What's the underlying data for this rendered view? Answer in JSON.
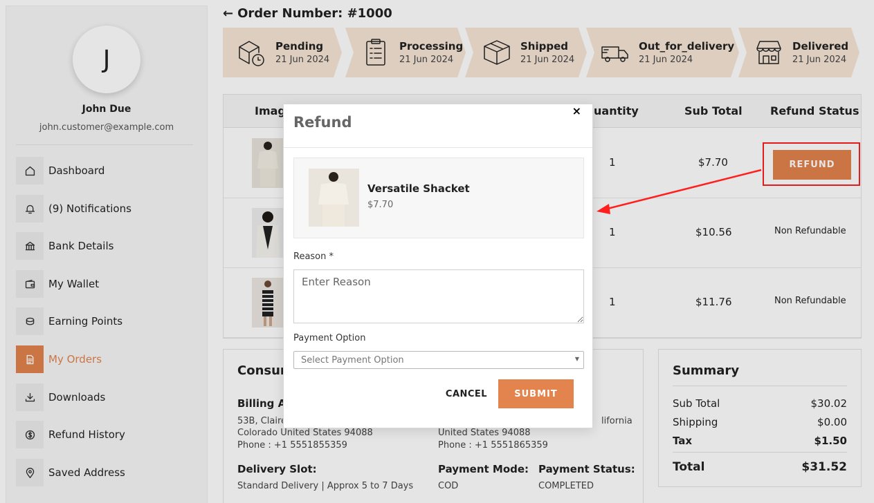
{
  "sidebar": {
    "avatar_initial": "J",
    "user_name": "John Due",
    "user_email": "john.customer@example.com",
    "items": [
      {
        "label": "Dashboard",
        "icon": "home-icon"
      },
      {
        "label": "(9)  Notifications",
        "icon": "bell-icon"
      },
      {
        "label": "Bank Details",
        "icon": "bank-icon"
      },
      {
        "label": "My Wallet",
        "icon": "wallet-icon"
      },
      {
        "label": "Earning Points",
        "icon": "coins-icon"
      },
      {
        "label": "My Orders",
        "icon": "document-icon",
        "active": true
      },
      {
        "label": "Downloads",
        "icon": "download-icon"
      },
      {
        "label": "Refund History",
        "icon": "dollar-circle-icon"
      },
      {
        "label": "Saved Address",
        "icon": "map-pin-icon"
      }
    ]
  },
  "order": {
    "title": "Order Number: #1000",
    "back_icon": "arrow-left-icon"
  },
  "status_steps": [
    {
      "name": "Pending",
      "date": "21 Jun 2024",
      "icon": "box-clock-icon"
    },
    {
      "name": "Processing",
      "date": "21 Jun 2024",
      "icon": "clipboard-icon"
    },
    {
      "name": "Shipped",
      "date": "21 Jun 2024",
      "icon": "package-icon"
    },
    {
      "name": "Out_for_delivery",
      "date": "21 Jun 2024",
      "icon": "truck-icon"
    },
    {
      "name": "Delivered",
      "date": "21 Jun 2024",
      "icon": "store-icon"
    }
  ],
  "table": {
    "headers": {
      "image": "Imag",
      "quantity": "uantity",
      "subtotal": "Sub Total",
      "refund_status": "Refund Status"
    },
    "rows": [
      {
        "quantity": "1",
        "subtotal": "$7.70",
        "refund_status": "REFUND",
        "refundable": true
      },
      {
        "quantity": "1",
        "subtotal": "$10.56",
        "refund_status": "Non Refundable",
        "refundable": false
      },
      {
        "quantity": "1",
        "subtotal": "$11.76",
        "refund_status": "Non Refundable",
        "refundable": false
      }
    ]
  },
  "consumer": {
    "title": "Consum",
    "billing_label": "Billing Ad",
    "billing_lines": [
      "53B, Claire",
      "Colorado United States 94088",
      "Phone : +1 5551855359"
    ],
    "shipping_lines": [
      "United States 94088",
      "Phone : +1 5551865359"
    ],
    "shipping_fragment": "lifornia",
    "delivery_slot_label": "Delivery Slot:",
    "delivery_slot_value": "Standard Delivery | Approx 5 to 7 Days",
    "payment_mode_label": "Payment Mode:",
    "payment_mode_value": "COD",
    "payment_status_label": "Payment Status:",
    "payment_status_value": "COMPLETED"
  },
  "summary": {
    "title": "Summary",
    "sub_total_label": "Sub Total",
    "sub_total": "$30.02",
    "shipping_label": "Shipping",
    "shipping": "$0.00",
    "tax_label": "Tax",
    "tax": "$1.50",
    "total_label": "Total",
    "total": "$31.52"
  },
  "modal": {
    "title": "Refund",
    "close_symbol": "×",
    "product_name": "Versatile Shacket",
    "product_price": "$7.70",
    "reason_label": "Reason *",
    "reason_placeholder": "Enter Reason",
    "payment_label": "Payment Option",
    "payment_placeholder": "Select Payment Option",
    "cancel_label": "CANCEL",
    "submit_label": "SUBMIT"
  },
  "colors": {
    "accent": "#e3834d",
    "status_step_bg": "#f6e6d6",
    "highlight_red": "#ff1f1f"
  }
}
